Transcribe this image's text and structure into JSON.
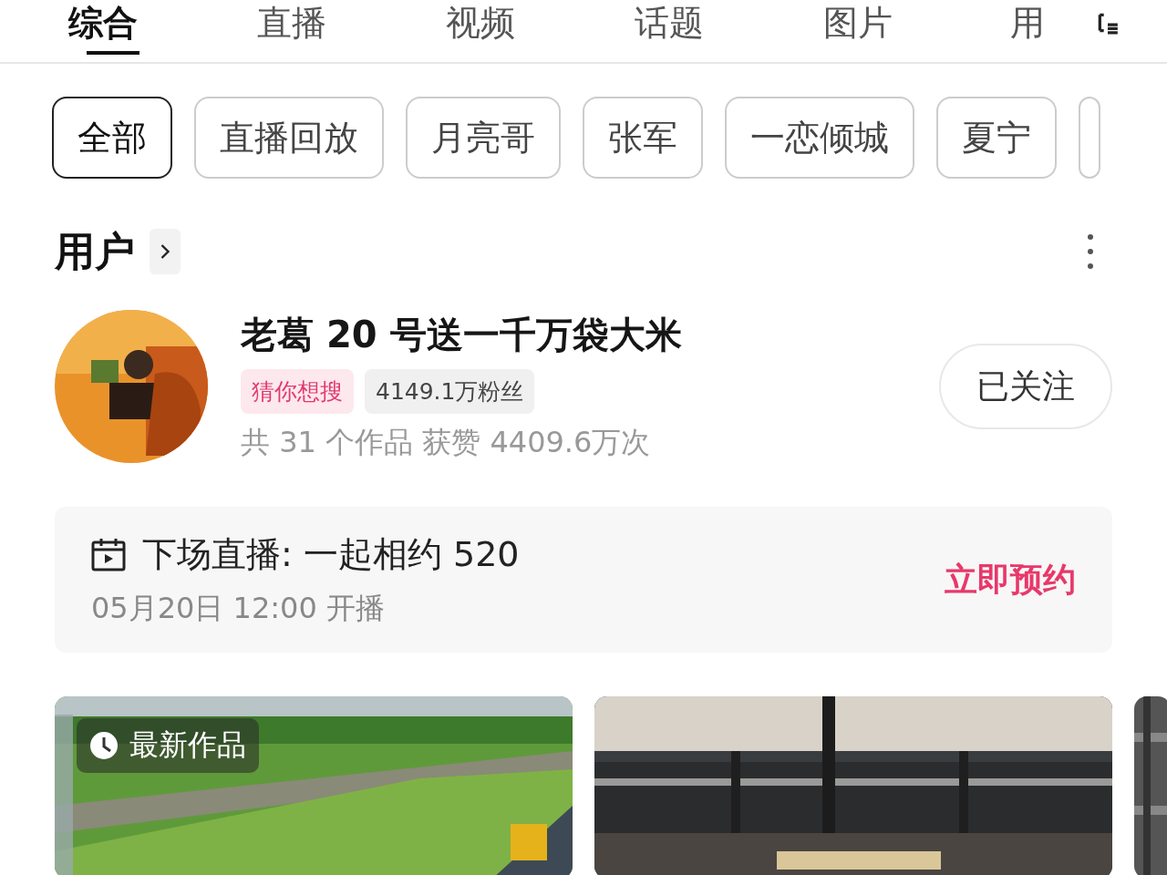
{
  "tabs": [
    {
      "label": "综合",
      "selected": true
    },
    {
      "label": "直播",
      "selected": false
    },
    {
      "label": "视频",
      "selected": false
    },
    {
      "label": "话题",
      "selected": false
    },
    {
      "label": "图片",
      "selected": false
    },
    {
      "label": "用",
      "selected": false
    }
  ],
  "chips": [
    {
      "label": "全部",
      "selected": true
    },
    {
      "label": "直播回放",
      "selected": false
    },
    {
      "label": "月亮哥",
      "selected": false
    },
    {
      "label": "张军",
      "selected": false
    },
    {
      "label": "一恋倾城",
      "selected": false
    },
    {
      "label": "夏宁",
      "selected": false
    }
  ],
  "section": {
    "title": "用户"
  },
  "user": {
    "name": "老葛 20 号送一千万袋大米",
    "tag": "猜你想搜",
    "fans": "4149.1万粉丝",
    "stats": "共 31 个作品  获赞 4409.6万次",
    "follow": {
      "label": "已关注",
      "following": true
    }
  },
  "live": {
    "title": "下场直播: 一起相约 520",
    "time": "05月20日 12:00 开播",
    "action": "立即预约"
  },
  "videos": [
    {
      "kind": "picture",
      "badge": "最新作品"
    },
    {
      "kind": "picture"
    }
  ]
}
